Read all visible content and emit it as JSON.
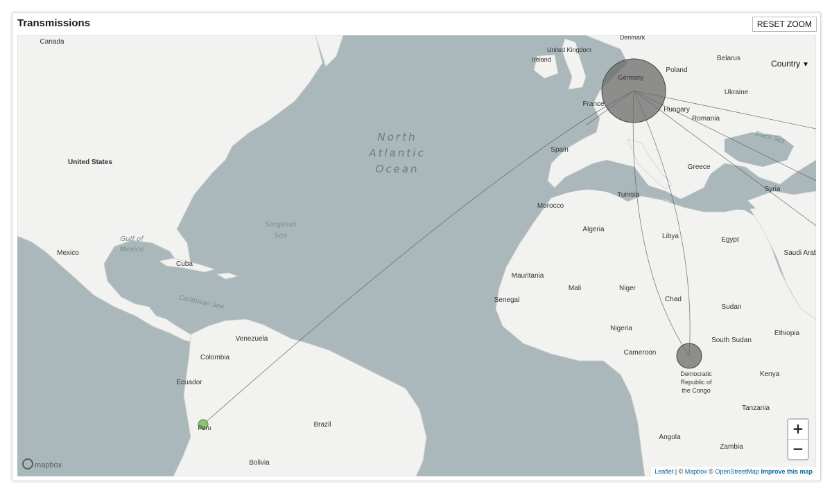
{
  "header": {
    "title": "Transmissions",
    "reset_zoom_label": "RESET ZOOM"
  },
  "map": {
    "grouping_select": {
      "selected": "Country",
      "icon": "chevron-down-icon"
    },
    "zoom": {
      "in_label": "+",
      "out_label": "−"
    },
    "logo_text": "mapbox",
    "attribution": {
      "leaflet": "Leaflet",
      "sep1": " | © ",
      "mapbox": "Mapbox",
      "sep2": " © ",
      "osm": "OpenStreetMap",
      "improve": "Improve this map"
    },
    "colors": {
      "water": "#aab8bc",
      "land": "#f2f2f0",
      "node": "#6b6b6b",
      "origin_node": "#7fbf6a",
      "link": "#555555"
    },
    "labels": {
      "oceans": [
        "North",
        "Atlantic",
        "Ocean"
      ],
      "seas": [
        "Sargasso",
        "Sea",
        "Gulf of",
        "Mexico",
        "Caribbean Sea",
        "Black Sea"
      ],
      "countries": [
        "Canada",
        "United States",
        "Mexico",
        "Cuba",
        "Venezuela",
        "Colombia",
        "Ecuador",
        "Peru",
        "Brazil",
        "Bolivia",
        "United Kingdom",
        "Ireland",
        "Denmark",
        "Belarus",
        "Poland",
        "Ukraine",
        "Germany",
        "France",
        "Spain",
        "Hungary",
        "Romania",
        "Greece",
        "Tunisia",
        "Morocco",
        "Algeria",
        "Libya",
        "Egypt",
        "Mauritania",
        "Mali",
        "Niger",
        "Chad",
        "Sudan",
        "Senegal",
        "Nigeria",
        "Cameroon",
        "South Sudan",
        "Ethiopia",
        "Kenya",
        "Tanzania",
        "Angola",
        "Zambia",
        "Syria",
        "Saudi Arab",
        "Democratic",
        "Republic of",
        "the Congo"
      ]
    },
    "nodes": [
      {
        "name": "Germany",
        "size": "large"
      },
      {
        "name": "Democratic Republic of the Congo",
        "size": "medium"
      },
      {
        "name": "Peru",
        "size": "small",
        "role": "origin"
      }
    ]
  }
}
